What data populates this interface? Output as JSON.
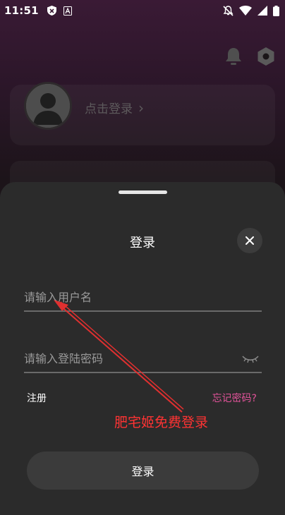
{
  "status_bar": {
    "time": "11:51"
  },
  "profile": {
    "login_hint": "点击登录",
    "chevron": "›"
  },
  "login_sheet": {
    "title": "登录",
    "username_placeholder": "请输入用户名",
    "password_placeholder": "请输入登陆密码",
    "register_label": "注册",
    "forgot_label": "忘记密码?",
    "submit_label": "登录"
  },
  "annotation": {
    "text": "肥宅姬免费登录",
    "color": "#ff3333"
  },
  "colors": {
    "accent_pink": "#e2539a",
    "sheet_bg": "#2b2b2b",
    "button_bg": "#3b3b3b"
  },
  "icons": [
    "shield-icon",
    "notification-a-icon",
    "mute-icon",
    "wifi-icon",
    "signal-icon",
    "battery-icon",
    "bell-icon",
    "settings-hex-icon",
    "close-icon",
    "eye-closed-icon"
  ]
}
